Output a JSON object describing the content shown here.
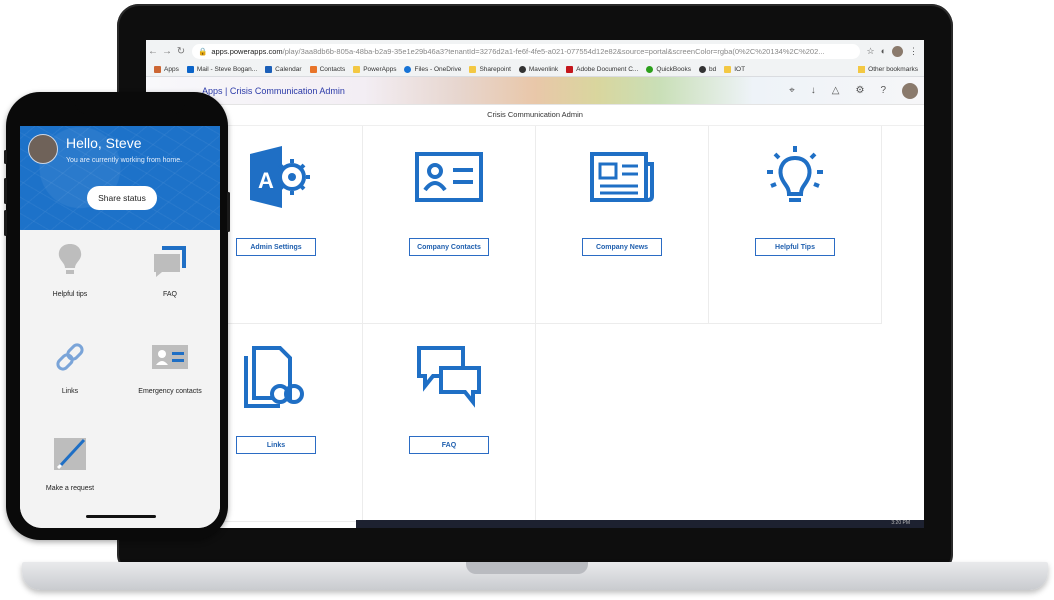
{
  "browser": {
    "url_host": "apps.powerapps.com",
    "url_rest": "/play/3aa8db6b-805a-48ba-b2a9-35e1e29b46a3?tenantId=3276d2a1-fe6f-4fe5-a021-077554d12e82&source=portal&screenColor=rgba(0%2C%20134%2C%202...",
    "bookmarks": [
      "Apps",
      "Mail - Steve Bogan...",
      "Calendar",
      "Contacts",
      "PowerApps",
      "Files - OneDrive",
      "Sharepoint",
      "Mavenlink",
      "Adobe Document C...",
      "QuickBooks",
      "bd",
      "IOT"
    ],
    "other_bookmarks": "Other bookmarks"
  },
  "app": {
    "title": "Apps  |  Crisis Communication Admin",
    "subtitle": "Crisis Communication Admin",
    "tiles": [
      {
        "label": "Admin Settings",
        "icon": "admin-settings-icon"
      },
      {
        "label": "Company Contacts",
        "icon": "contact-card-icon"
      },
      {
        "label": "Company News",
        "icon": "newspaper-icon"
      },
      {
        "label": "Helpful Tips",
        "icon": "lightbulb-icon"
      },
      {
        "label": "Links",
        "icon": "links-document-icon"
      },
      {
        "label": "FAQ",
        "icon": "chat-bubbles-icon"
      }
    ],
    "accent": "#1f6fc5",
    "tray_time": "3:20 PM"
  },
  "phone": {
    "greeting": "Hello, Steve",
    "status_text": "You are currently working from home.",
    "share_button": "Share status",
    "items": [
      {
        "label": "Helpful tips",
        "icon": "lightbulb-icon"
      },
      {
        "label": "FAQ",
        "icon": "chat-icon"
      },
      {
        "label": "Links",
        "icon": "link-icon"
      },
      {
        "label": "Emergency contacts",
        "icon": "contact-card-icon"
      },
      {
        "label": "Make a request",
        "icon": "pencil-icon"
      }
    ],
    "hero_color": "#1d72c9"
  }
}
